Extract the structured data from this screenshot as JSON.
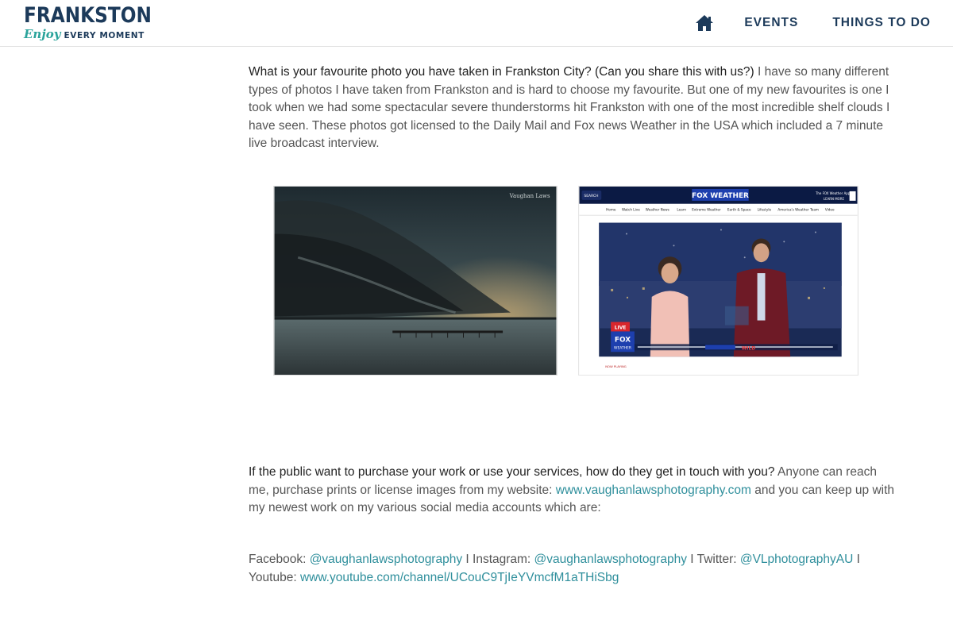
{
  "header": {
    "logo_main": "FRANKSTON",
    "logo_enjoy": "Enjoy",
    "logo_tagline": "EVERY MOMENT",
    "nav": [
      {
        "label": "EVENTS"
      },
      {
        "label": "THINGS TO DO"
      }
    ]
  },
  "article": {
    "q1": "What is your favourite photo you have taken in Frankston City? (Can you share this with us?)",
    "a1": " I have so many different types of photos I have taken from Frankston and is hard to choose my favourite.  But one of my new favourites is one I took when we had some spectacular severe thunderstorms hit Frankston with one of the most incredible shelf clouds I have seen. These photos got licensed to the Daily Mail and Fox news Weather in the USA which included a 7 minute live broadcast interview.",
    "q2": "If the public want to purchase your work or use your services, how do they get in touch with you?",
    "a2_pre": "  Anyone can reach me, purchase prints or license images from my website: ",
    "a2_link": "www.vaughanlawsphotography.com",
    "a2_post": " and you can keep up with my newest work on my various social media accounts which are:",
    "social": {
      "facebook_label": "Facebook: ",
      "facebook": "@vaughanlawsphotography",
      "sep1": "  I  Instagram: ",
      "instagram": "@vaughanlawsphotography",
      "sep2": "  I  Twitter: ",
      "twitter": "@VLphotographyAU",
      "sep3": "  I   Youtube: ",
      "youtube": "www.youtube.com/channel/UCouC9TjIeYVmcfM1aTHiSbg"
    }
  },
  "images": {
    "fox_logo": "FOX WEATHER",
    "fox_search": "SEARCH",
    "fox_app": "The FOX Weather App",
    "fox_learn": "LEARN MORE",
    "fox_menu": [
      "Home",
      "Watch Live",
      "Weather News",
      "Learn",
      "Extreme Weather",
      "Earth & Space",
      "Lifestyle",
      "America's Weather Team",
      "Video"
    ],
    "fox_live": "LIVE",
    "fox_bug": "FOX",
    "fox_bug2": "WEATHER",
    "fox_now_playing": "NOW PLAYING",
    "fox_ticker": "WILD",
    "storm_watermark": "Vaughan Laws"
  },
  "colors": {
    "brand_navy": "#1c3a5a",
    "brand_teal": "#2aa39b",
    "link": "#2f8f9c"
  }
}
